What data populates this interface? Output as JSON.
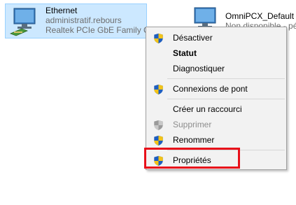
{
  "adapters": [
    {
      "name": "Ethernet",
      "line2": "administratif.rebours",
      "line3": "Realtek PCIe GbE Family Controller",
      "selected": true
    },
    {
      "name": "OmniPCX_Default",
      "line2": "Non disponible - pé"
    }
  ],
  "context_menu": {
    "items": [
      {
        "label": "Désactiver",
        "icon": "uac-shield-icon"
      },
      {
        "label": "Statut",
        "bold": true
      },
      {
        "label": "Diagnostiquer"
      },
      {
        "label": "Connexions de pont",
        "icon": "uac-shield-icon"
      },
      {
        "label": "Créer un raccourci"
      },
      {
        "label": "Supprimer",
        "icon": "uac-shield-icon",
        "disabled": true
      },
      {
        "label": "Renommer",
        "icon": "uac-shield-icon"
      },
      {
        "label": "Propriétés",
        "icon": "uac-shield-icon",
        "highlighted": true
      }
    ]
  },
  "colors": {
    "selection_bg": "#cce8ff",
    "highlight_border": "#e8101a",
    "menu_bg": "#f2f2f2"
  }
}
